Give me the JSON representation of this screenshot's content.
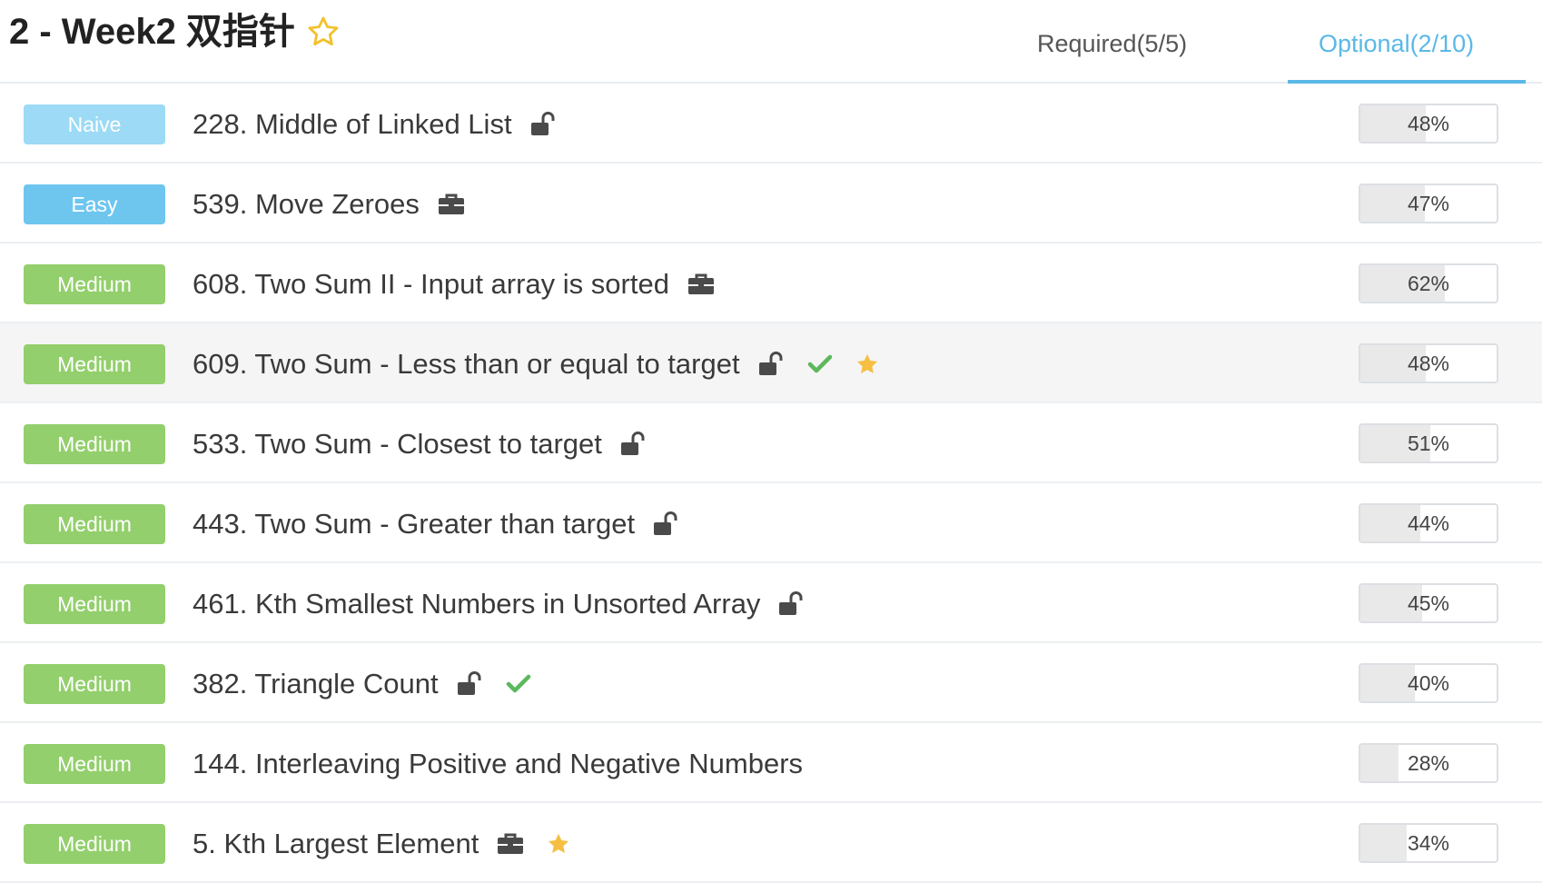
{
  "header": {
    "title": "2 - Week2 双指针",
    "tabs": [
      {
        "label": "Required(5/5)",
        "active": false
      },
      {
        "label": "Optional(2/10)",
        "active": true
      }
    ]
  },
  "colors": {
    "accent": "#5ab8e6",
    "naive": "#9cdaf5",
    "easy": "#6ec6ef",
    "medium": "#93cf6c",
    "check": "#5cb85c",
    "star": "#f5bf42"
  },
  "problems": [
    {
      "difficulty": "Naive",
      "title": "228. Middle of Linked List",
      "icons": [
        "unlock-icon"
      ],
      "rate": "48%",
      "progress": 0.48
    },
    {
      "difficulty": "Easy",
      "title": "539. Move Zeroes",
      "icons": [
        "briefcase-icon"
      ],
      "rate": "47%",
      "progress": 0.47
    },
    {
      "difficulty": "Medium",
      "title": "608. Two Sum II - Input array is sorted",
      "icons": [
        "briefcase-icon"
      ],
      "rate": "62%",
      "progress": 0.62
    },
    {
      "difficulty": "Medium",
      "title": "609. Two Sum - Less than or equal to target",
      "icons": [
        "unlock-icon",
        "check-icon",
        "star-icon"
      ],
      "rate": "48%",
      "progress": 0.48,
      "highlighted": true
    },
    {
      "difficulty": "Medium",
      "title": "533. Two Sum - Closest to target",
      "icons": [
        "unlock-icon"
      ],
      "rate": "51%",
      "progress": 0.51
    },
    {
      "difficulty": "Medium",
      "title": "443. Two Sum - Greater than target",
      "icons": [
        "unlock-icon"
      ],
      "rate": "44%",
      "progress": 0.44
    },
    {
      "difficulty": "Medium",
      "title": "461. Kth Smallest Numbers in Unsorted Array",
      "icons": [
        "unlock-icon"
      ],
      "rate": "45%",
      "progress": 0.45
    },
    {
      "difficulty": "Medium",
      "title": "382. Triangle Count",
      "icons": [
        "unlock-icon",
        "check-icon"
      ],
      "rate": "40%",
      "progress": 0.4
    },
    {
      "difficulty": "Medium",
      "title": "144. Interleaving Positive and Negative Numbers",
      "icons": [],
      "rate": "28%",
      "progress": 0.28
    },
    {
      "difficulty": "Medium",
      "title": "5. Kth Largest Element",
      "icons": [
        "briefcase-icon",
        "star-icon"
      ],
      "rate": "34%",
      "progress": 0.34
    }
  ]
}
